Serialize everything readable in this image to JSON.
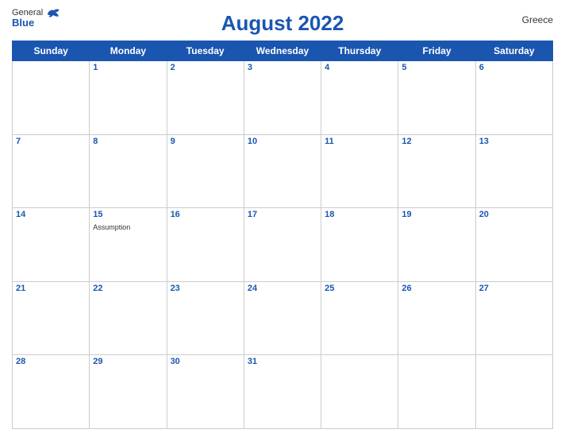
{
  "header": {
    "logo_general": "General",
    "logo_blue": "Blue",
    "title": "August 2022",
    "country": "Greece"
  },
  "days_of_week": [
    "Sunday",
    "Monday",
    "Tuesday",
    "Wednesday",
    "Thursday",
    "Friday",
    "Saturday"
  ],
  "weeks": [
    [
      {
        "num": "",
        "empty": true
      },
      {
        "num": "1",
        "empty": false,
        "event": ""
      },
      {
        "num": "2",
        "empty": false,
        "event": ""
      },
      {
        "num": "3",
        "empty": false,
        "event": ""
      },
      {
        "num": "4",
        "empty": false,
        "event": ""
      },
      {
        "num": "5",
        "empty": false,
        "event": ""
      },
      {
        "num": "6",
        "empty": false,
        "event": ""
      }
    ],
    [
      {
        "num": "7",
        "empty": false,
        "event": ""
      },
      {
        "num": "8",
        "empty": false,
        "event": ""
      },
      {
        "num": "9",
        "empty": false,
        "event": ""
      },
      {
        "num": "10",
        "empty": false,
        "event": ""
      },
      {
        "num": "11",
        "empty": false,
        "event": ""
      },
      {
        "num": "12",
        "empty": false,
        "event": ""
      },
      {
        "num": "13",
        "empty": false,
        "event": ""
      }
    ],
    [
      {
        "num": "14",
        "empty": false,
        "event": ""
      },
      {
        "num": "15",
        "empty": false,
        "event": "Assumption"
      },
      {
        "num": "16",
        "empty": false,
        "event": ""
      },
      {
        "num": "17",
        "empty": false,
        "event": ""
      },
      {
        "num": "18",
        "empty": false,
        "event": ""
      },
      {
        "num": "19",
        "empty": false,
        "event": ""
      },
      {
        "num": "20",
        "empty": false,
        "event": ""
      }
    ],
    [
      {
        "num": "21",
        "empty": false,
        "event": ""
      },
      {
        "num": "22",
        "empty": false,
        "event": ""
      },
      {
        "num": "23",
        "empty": false,
        "event": ""
      },
      {
        "num": "24",
        "empty": false,
        "event": ""
      },
      {
        "num": "25",
        "empty": false,
        "event": ""
      },
      {
        "num": "26",
        "empty": false,
        "event": ""
      },
      {
        "num": "27",
        "empty": false,
        "event": ""
      }
    ],
    [
      {
        "num": "28",
        "empty": false,
        "event": ""
      },
      {
        "num": "29",
        "empty": false,
        "event": ""
      },
      {
        "num": "30",
        "empty": false,
        "event": ""
      },
      {
        "num": "31",
        "empty": false,
        "event": ""
      },
      {
        "num": "",
        "empty": true
      },
      {
        "num": "",
        "empty": true
      },
      {
        "num": "",
        "empty": true
      }
    ]
  ],
  "colors": {
    "header_bg": "#1a56b0",
    "day_num_color": "#1a56b0"
  }
}
